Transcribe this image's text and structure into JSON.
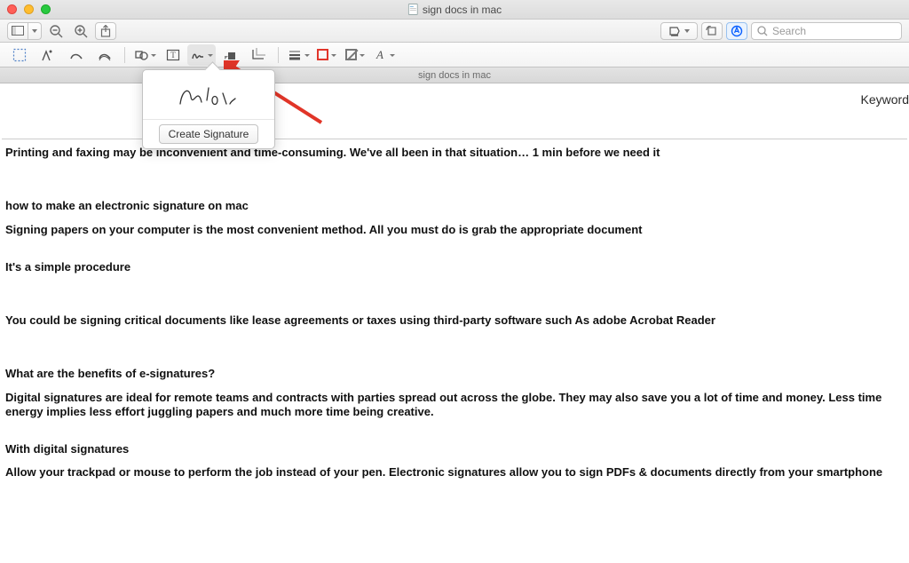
{
  "window": {
    "title": "sign docs in mac"
  },
  "toolbar": {
    "search_placeholder": "Search"
  },
  "docbar": {
    "filename": "sign docs in mac"
  },
  "popover": {
    "signature_sample": "Sign",
    "create_label": "Create Signature"
  },
  "content": {
    "keyword_label": "Keyword",
    "paragraphs": {
      "p1": "Printing and faxing may be inconvenient and time-consuming. We've all been in that situation… 1 min before we need it",
      "h2": "how to make an electronic signature on mac",
      "p2": "Signing papers on your computer is the most convenient method. All you must do is grab the appropriate document",
      "p3": "It's a simple procedure",
      "p4": "You could be signing critical documents like lease agreements or taxes using third-party software such As adobe Acrobat Reader",
      "h3": "What are the benefits of e-signatures?",
      "p5": "Digital signatures are ideal for remote teams and contracts with parties spread out across the globe. They may also save you a lot of time and money. Less time energy implies less effort juggling papers and much more time being creative.",
      "h4": "With digital signatures",
      "p6": "Allow your trackpad or mouse to perform the job instead of your pen. Electronic signatures allow you to sign PDFs & documents directly from your smartphone"
    }
  }
}
